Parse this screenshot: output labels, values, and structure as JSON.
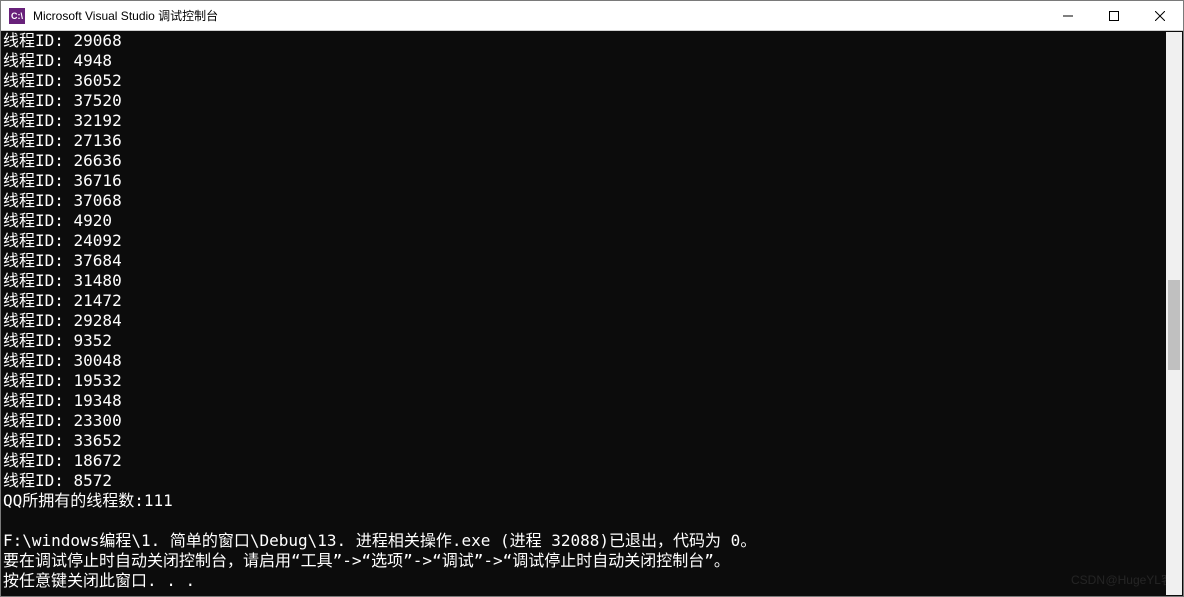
{
  "window": {
    "title": "Microsoft Visual Studio 调试控制台",
    "icon_label": "C:\\"
  },
  "console": {
    "thread_label": "线程ID: ",
    "thread_ids": [
      "29068",
      "4948",
      "36052",
      "37520",
      "32192",
      "27136",
      "26636",
      "36716",
      "37068",
      "4920",
      "24092",
      "37684",
      "31480",
      "21472",
      "29284",
      "9352",
      "30048",
      "19532",
      "19348",
      "23300",
      "33652",
      "18672",
      "8572"
    ],
    "summary_line": "QQ所拥有的线程数:111",
    "blank": "",
    "exit_line": "F:\\windows编程\\1. 简单的窗口\\Debug\\13. 进程相关操作.exe (进程 32088)已退出，代码为 0。",
    "hint_line": "要在调试停止时自动关闭控制台，请启用“工具”->“选项”->“调试”->“调试停止时自动关闭控制台”。",
    "press_key_line": "按任意键关闭此窗口. . ."
  },
  "watermarks": {
    "right": "@HugeYL客",
    "left": "CSDN"
  }
}
